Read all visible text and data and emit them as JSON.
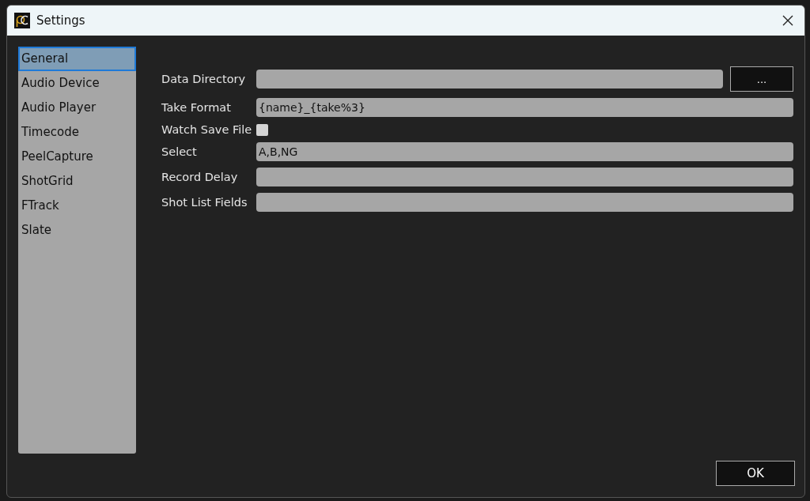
{
  "window": {
    "title": "Settings"
  },
  "sidebar": {
    "items": [
      {
        "label": "General",
        "selected": true
      },
      {
        "label": "Audio Device",
        "selected": false
      },
      {
        "label": "Audio Player",
        "selected": false
      },
      {
        "label": "Timecode",
        "selected": false
      },
      {
        "label": "PeelCapture",
        "selected": false
      },
      {
        "label": "ShotGrid",
        "selected": false
      },
      {
        "label": "FTrack",
        "selected": false
      },
      {
        "label": "Slate",
        "selected": false
      }
    ]
  },
  "form": {
    "rows": [
      {
        "kind": "browse",
        "label": "Data Directory",
        "button": "..."
      },
      {
        "kind": "text",
        "label": "Take Format",
        "value": "{name}_{take%3}"
      },
      {
        "kind": "checkbox",
        "label": "Watch Save File",
        "checked": false
      },
      {
        "kind": "text",
        "label": "Select",
        "value": "A,B,NG"
      },
      {
        "kind": "text",
        "label": "Record Delay"
      },
      {
        "kind": "text",
        "label": "Shot List Fields"
      }
    ]
  },
  "buttons": [
    "OK"
  ]
}
